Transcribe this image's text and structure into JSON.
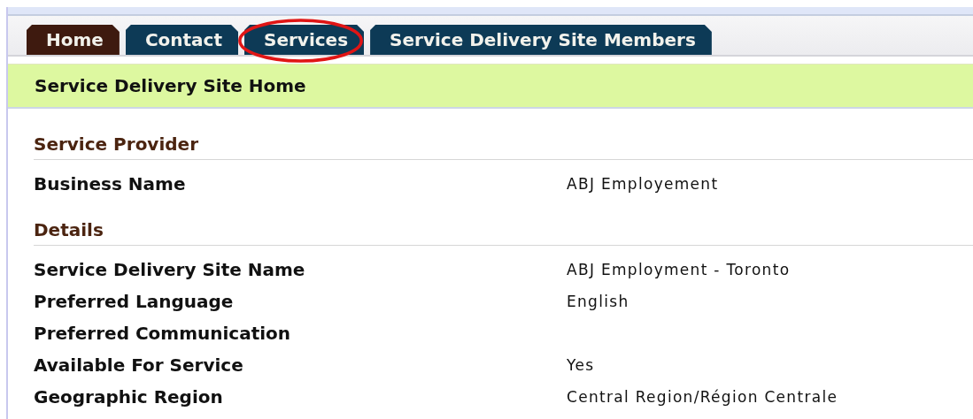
{
  "tabs": [
    {
      "label": "Home",
      "selected": true,
      "highlighted": false
    },
    {
      "label": "Contact",
      "selected": false,
      "highlighted": false
    },
    {
      "label": "Services",
      "selected": false,
      "highlighted": true
    },
    {
      "label": "Service Delivery Site Members",
      "selected": false,
      "highlighted": false
    }
  ],
  "page_title": "Service Delivery Site Home",
  "sections": [
    {
      "heading": "Service Provider",
      "fields": [
        {
          "label": "Business Name",
          "value": "ABJ Employement"
        }
      ]
    },
    {
      "heading": "Details",
      "fields": [
        {
          "label": "Service Delivery Site Name",
          "value": "ABJ Employment - Toronto"
        },
        {
          "label": "Preferred Language",
          "value": "English"
        },
        {
          "label": "Preferred Communication"
        },
        {
          "label": "Available For Service",
          "value": "Yes"
        },
        {
          "label": "Geographic Region",
          "value": "Central Region/Région Centrale"
        }
      ]
    }
  ]
}
